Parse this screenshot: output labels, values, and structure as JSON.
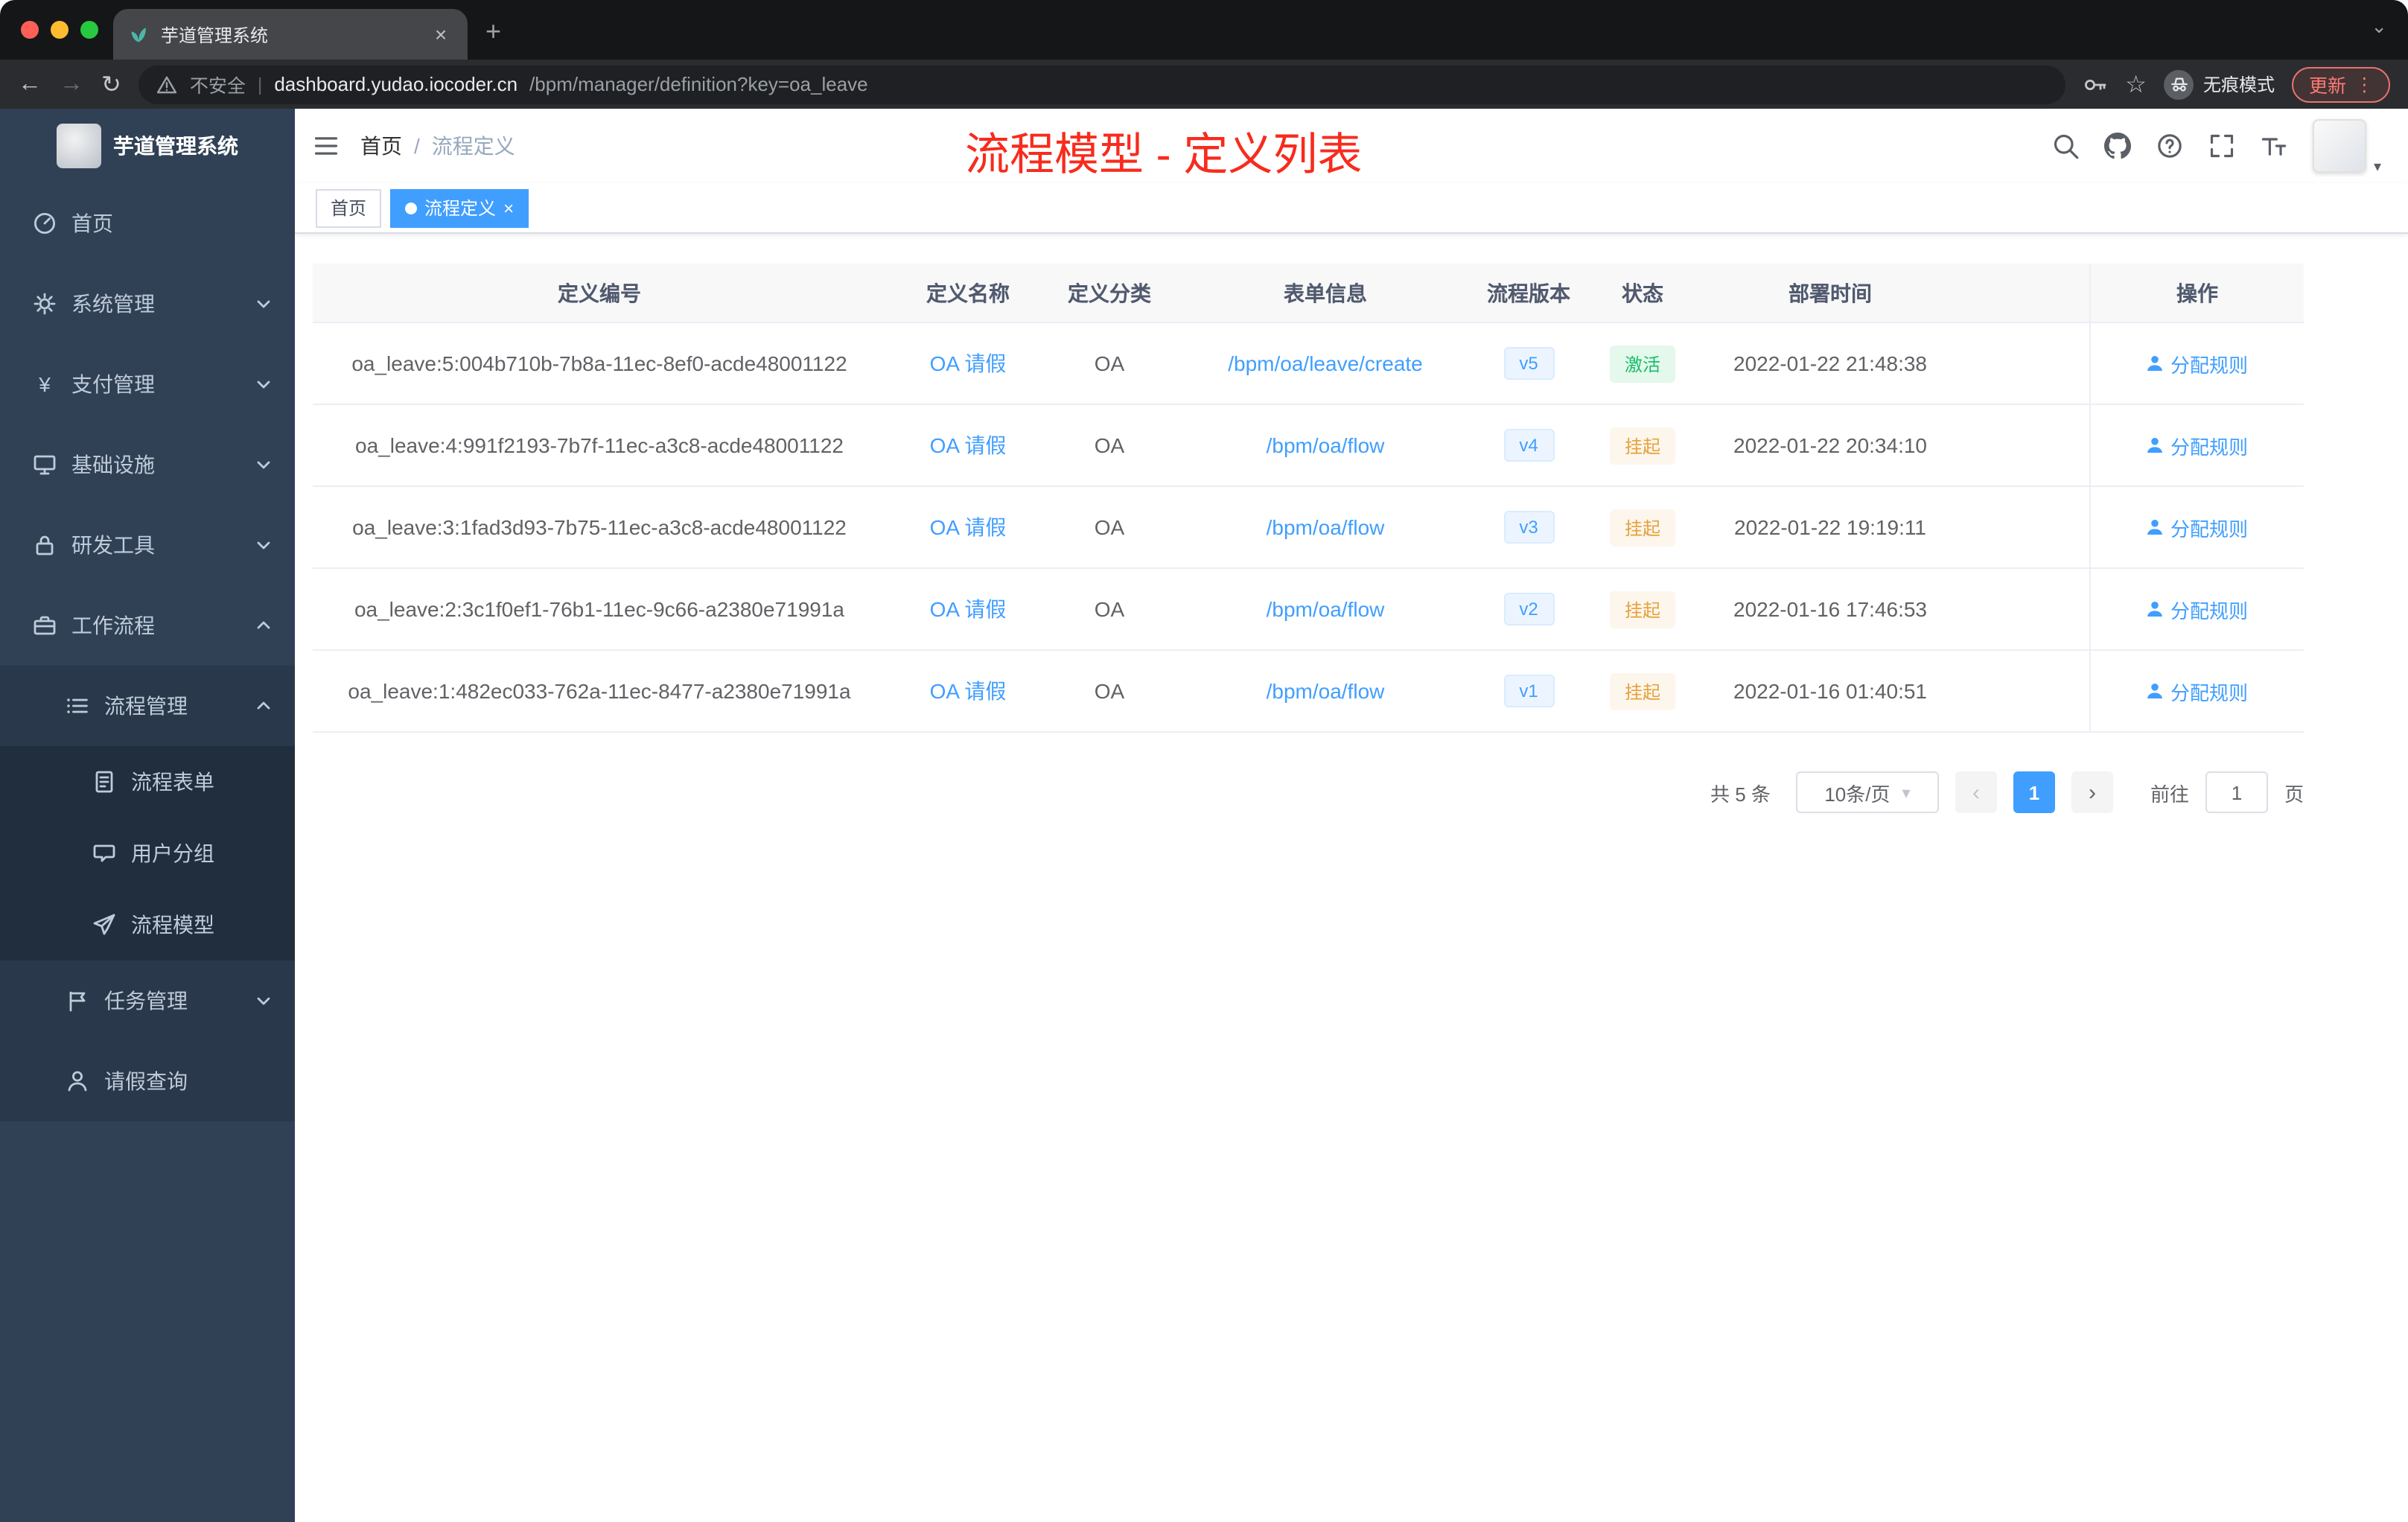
{
  "colors": {
    "accent_blue": "#409eff",
    "sidebar_bg": "#304156",
    "annotation_red": "#f82b1d",
    "status_active_text": "#19be6b",
    "status_suspended_text": "#e6a23c",
    "update_chip_red": "#ee675c"
  },
  "icons": {
    "close": "×",
    "new_tab": "+",
    "strip_chevron": "⌄",
    "back": "←",
    "forward": "→",
    "reload": "↻",
    "star": "☆",
    "more": "⋮",
    "caret_down": "▾",
    "prev": "‹",
    "next": "›",
    "yen": "¥"
  },
  "browser": {
    "tab": {
      "title": "芋道管理系统"
    },
    "toolbar": {
      "security_label": "不安全",
      "url_domain": "dashboard.yudao.iocoder.cn",
      "url_path": "/bpm/manager/definition?key=oa_leave",
      "incognito_label": "无痕模式",
      "update_label": "更新"
    }
  },
  "sidebar": {
    "logo_title": "芋道管理系统",
    "items": [
      {
        "label": "首页"
      },
      {
        "label": "系统管理"
      },
      {
        "label": "支付管理"
      },
      {
        "label": "基础设施"
      },
      {
        "label": "研发工具"
      },
      {
        "label": "工作流程"
      },
      {
        "label": "流程管理"
      },
      {
        "label": "流程表单"
      },
      {
        "label": "用户分组"
      },
      {
        "label": "流程模型"
      },
      {
        "label": "任务管理"
      },
      {
        "label": "请假查询"
      }
    ]
  },
  "header": {
    "breadcrumb_home": "首页",
    "breadcrumb_sep": "/",
    "breadcrumb_current": "流程定义",
    "annotation": "流程模型 - 定义列表"
  },
  "tags": {
    "home": "首页",
    "active": "流程定义"
  },
  "table": {
    "columns": [
      "定义编号",
      "定义名称",
      "定义分类",
      "表单信息",
      "流程版本",
      "状态",
      "部署时间",
      "操作"
    ],
    "rows": [
      {
        "id": "oa_leave:5:004b710b-7b8a-11ec-8ef0-acde48001122",
        "name": "OA 请假",
        "category": "OA",
        "form": "/bpm/oa/leave/create",
        "version": "v5",
        "status": "激活",
        "status_type": "success",
        "time": "2022-01-22 21:48:38",
        "action": "分配规则"
      },
      {
        "id": "oa_leave:4:991f2193-7b7f-11ec-a3c8-acde48001122",
        "name": "OA 请假",
        "category": "OA",
        "form": "/bpm/oa/flow",
        "version": "v4",
        "status": "挂起",
        "status_type": "warning",
        "time": "2022-01-22 20:34:10",
        "action": "分配规则"
      },
      {
        "id": "oa_leave:3:1fad3d93-7b75-11ec-a3c8-acde48001122",
        "name": "OA 请假",
        "category": "OA",
        "form": "/bpm/oa/flow",
        "version": "v3",
        "status": "挂起",
        "status_type": "warning",
        "time": "2022-01-22 19:19:11",
        "action": "分配规则"
      },
      {
        "id": "oa_leave:2:3c1f0ef1-76b1-11ec-9c66-a2380e71991a",
        "name": "OA 请假",
        "category": "OA",
        "form": "/bpm/oa/flow",
        "version": "v2",
        "status": "挂起",
        "status_type": "warning",
        "time": "2022-01-16 17:46:53",
        "action": "分配规则"
      },
      {
        "id": "oa_leave:1:482ec033-762a-11ec-8477-a2380e71991a",
        "name": "OA 请假",
        "category": "OA",
        "form": "/bpm/oa/flow",
        "version": "v1",
        "status": "挂起",
        "status_type": "warning",
        "time": "2022-01-16 01:40:51",
        "action": "分配规则"
      }
    ]
  },
  "pagination": {
    "total": "共 5 条",
    "page_size": "10条/页",
    "page": "1",
    "goto_label": "前往",
    "goto_value": "1",
    "unit_label": "页"
  }
}
